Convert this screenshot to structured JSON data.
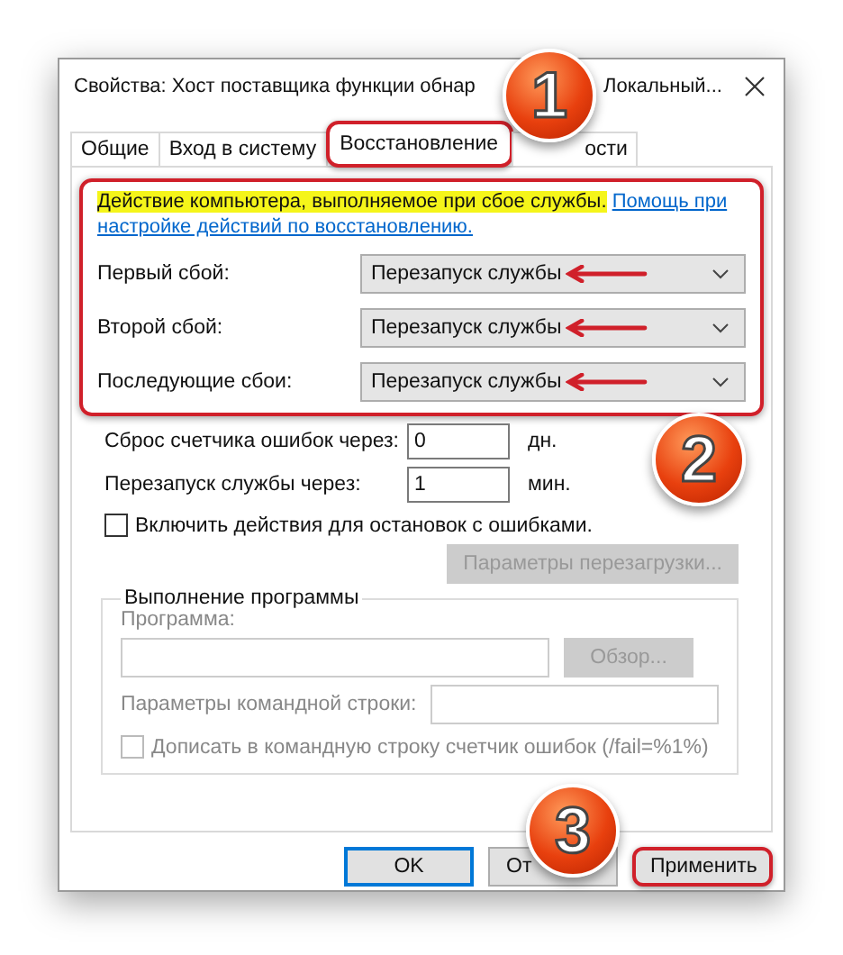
{
  "window": {
    "title_start": "Свойства: Хост поставщика функции обнар",
    "title_end": "Локальный..."
  },
  "tabs": [
    {
      "label": "Общие",
      "selected": false,
      "highlighted": false
    },
    {
      "label": "Вход в систему",
      "selected": false,
      "highlighted": false
    },
    {
      "label": "Восстановление",
      "selected": true,
      "highlighted": true
    },
    {
      "label": "ости",
      "selected": false,
      "highlighted": false
    }
  ],
  "recovery": {
    "highlighted": true,
    "description": "Действие компьютера, выполняемое при сбое службы.",
    "description_highlighted": true,
    "link_lines": [
      "Помощь при",
      "настройке действий по восстановлению."
    ],
    "failures": [
      {
        "label": "Первый сбой:",
        "value": "Перезапуск службы",
        "arrow": true
      },
      {
        "label": "Второй сбой:",
        "value": "Перезапуск службы",
        "arrow": true
      },
      {
        "label": "Последующие сбои:",
        "value": "Перезапуск службы",
        "arrow": true
      }
    ]
  },
  "counters": [
    {
      "label": "Сброс счетчика ошибок через:",
      "value": "0",
      "unit": "дн."
    },
    {
      "label": "Перезапуск службы через:",
      "value": "1",
      "unit": "мин."
    }
  ],
  "enable_actions": {
    "label": "Включить действия для остановок с ошибками.",
    "checked": false
  },
  "restart_options_button": {
    "label": "Параметры перезагрузки...",
    "disabled": true
  },
  "run_program": {
    "title": "Выполнение программы",
    "disabled": true,
    "program_label": "Программа:",
    "browse": "Обзор...",
    "params_label": "Параметры командной строки:",
    "append": {
      "label": "Дописать в командную строку счетчик ошибок (/fail=%1%)",
      "checked": false
    }
  },
  "buttons": [
    {
      "label": "OK",
      "kind": "default",
      "highlighted": false
    },
    {
      "label": "От",
      "kind": "normal",
      "highlighted": false
    },
    {
      "label": "Применить",
      "kind": "normal",
      "highlighted": true
    }
  ],
  "markers": [
    {
      "number": "1"
    },
    {
      "number": "2"
    },
    {
      "number": "3"
    }
  ]
}
